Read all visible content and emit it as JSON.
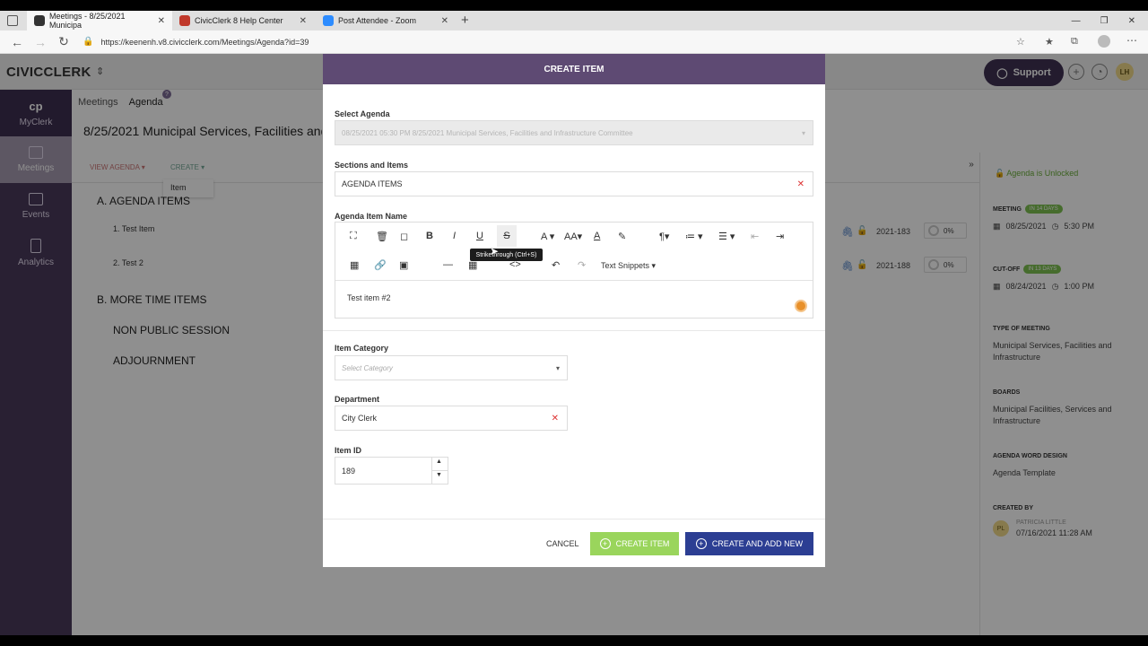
{
  "browser": {
    "tabs": [
      {
        "title": "Meetings - 8/25/2021 Municipa",
        "color": "#333333"
      },
      {
        "title": "CivicClerk 8 Help Center",
        "color": "#c0392b"
      },
      {
        "title": "Post Attendee - Zoom",
        "color": "#2d8cff"
      }
    ],
    "new_tab": "+",
    "url": "https://keenenh.v8.civicclerk.com/Meetings/Agenda?id=39"
  },
  "app": {
    "logo": "CIVICCLERK",
    "support_label": "Support",
    "avatar_initials": "LH",
    "sidebar": [
      {
        "label": "MyClerk"
      },
      {
        "label": "Meetings"
      },
      {
        "label": "Events"
      },
      {
        "label": "Analytics"
      }
    ],
    "breadcrumbs": [
      "Meetings",
      "Agenda"
    ],
    "help_badge": "?",
    "meeting_title": "8/25/2021 Municipal Services, Facilities and",
    "view_agenda": "VIEW AGENDA",
    "create_label": "CREATE",
    "create_menu_item": "Item",
    "sections": [
      {
        "label": "A.  AGENDA ITEMS"
      },
      {
        "label": "B.  MORE TIME ITEMS"
      },
      {
        "label": "NON PUBLIC SESSION"
      },
      {
        "label": "ADJOURNMENT"
      }
    ],
    "items": [
      {
        "label": "1.  Test Item",
        "id": "2021-183",
        "progress": "0%"
      },
      {
        "label": "2.  Test 2",
        "id": "2021-188",
        "progress": "0%"
      }
    ],
    "collapse_icon": "»"
  },
  "right_panel": {
    "unlocked": "Agenda is Unlocked",
    "meeting_label": "MEETING",
    "meeting_badge": "IN 14 DAYS",
    "meeting_date": "08/25/2021",
    "meeting_time": "5:30 PM",
    "cutoff_label": "CUT-OFF",
    "cutoff_badge": "IN 13 DAYS",
    "cutoff_date": "08/24/2021",
    "cutoff_time": "1:00 PM",
    "type_label": "TYPE OF MEETING",
    "type_value": "Municipal Services, Facilities and Infrastructure",
    "boards_label": "BOARDS",
    "boards_value": "Municipal Facilities, Services and Infrastructure",
    "word_design_label": "AGENDA WORD DESIGN",
    "word_design_value": "Agenda Template",
    "created_by_label": "CREATED BY",
    "created_by_initials": "PL",
    "created_by_name": "PATRICIA LITTLE",
    "created_by_date": "07/16/2021 11:28 AM"
  },
  "modal": {
    "title": "CREATE ITEM",
    "select_agenda_label": "Select Agenda",
    "select_agenda_value": "08/25/2021 05:30 PM 8/25/2021 Municipal Services, Facilities and Infrastructure Committee",
    "sections_label": "Sections and Items",
    "sections_value": "AGENDA ITEMS",
    "item_name_label": "Agenda Item Name",
    "toolbar": {
      "row1": [
        "⛶",
        "🗑",
        "◻",
        "B",
        "I",
        "U",
        "S",
        "A",
        "AA",
        "A",
        "🖌",
        "¶",
        "≔",
        "•",
        "⇤",
        "⇥"
      ],
      "row2": [
        "▦",
        "🔗",
        "🖼",
        "—",
        "▦",
        "<>",
        "↶",
        "↷"
      ],
      "text_snippets": "Text Snippets"
    },
    "tooltip": "Strikethrough (Ctrl+S)",
    "item_name_value": "Test item #2",
    "category_label": "Item Category",
    "category_placeholder": "Select Category",
    "department_label": "Department",
    "department_value": "City Clerk",
    "item_id_label": "Item ID",
    "item_id_value": "189",
    "cancel_label": "CANCEL",
    "create_label": "CREATE ITEM",
    "create_new_label": "CREATE AND ADD NEW"
  }
}
